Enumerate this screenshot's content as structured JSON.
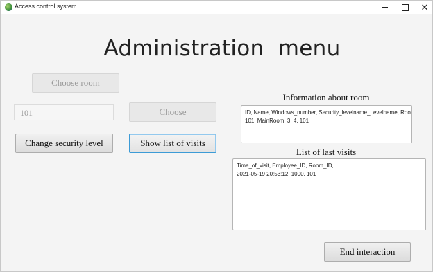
{
  "window": {
    "title": "Access control system",
    "controls": {
      "minimize": "–",
      "maximize": "□",
      "close": "✕"
    }
  },
  "main": {
    "heading": "Administration  menu",
    "choose_room_button": "Choose room",
    "room_id_field": {
      "value": "101"
    },
    "choose_button": "Choose",
    "change_security_button": "Change security level",
    "show_visits_button": "Show list of visits",
    "end_interaction_button": "End interaction"
  },
  "room_info": {
    "label": "Information about room",
    "lines": [
      "ID, Name, Windows_number, Security_levelname_Levelname, Room_ID,",
      "101, MainRoom, 3, 4, 101"
    ]
  },
  "visits": {
    "label": "List of last visits",
    "lines": [
      "Time_of_visit, Employee_ID, Room_ID,",
      "2021-05-19 20:53:12, 1000, 101"
    ]
  }
}
